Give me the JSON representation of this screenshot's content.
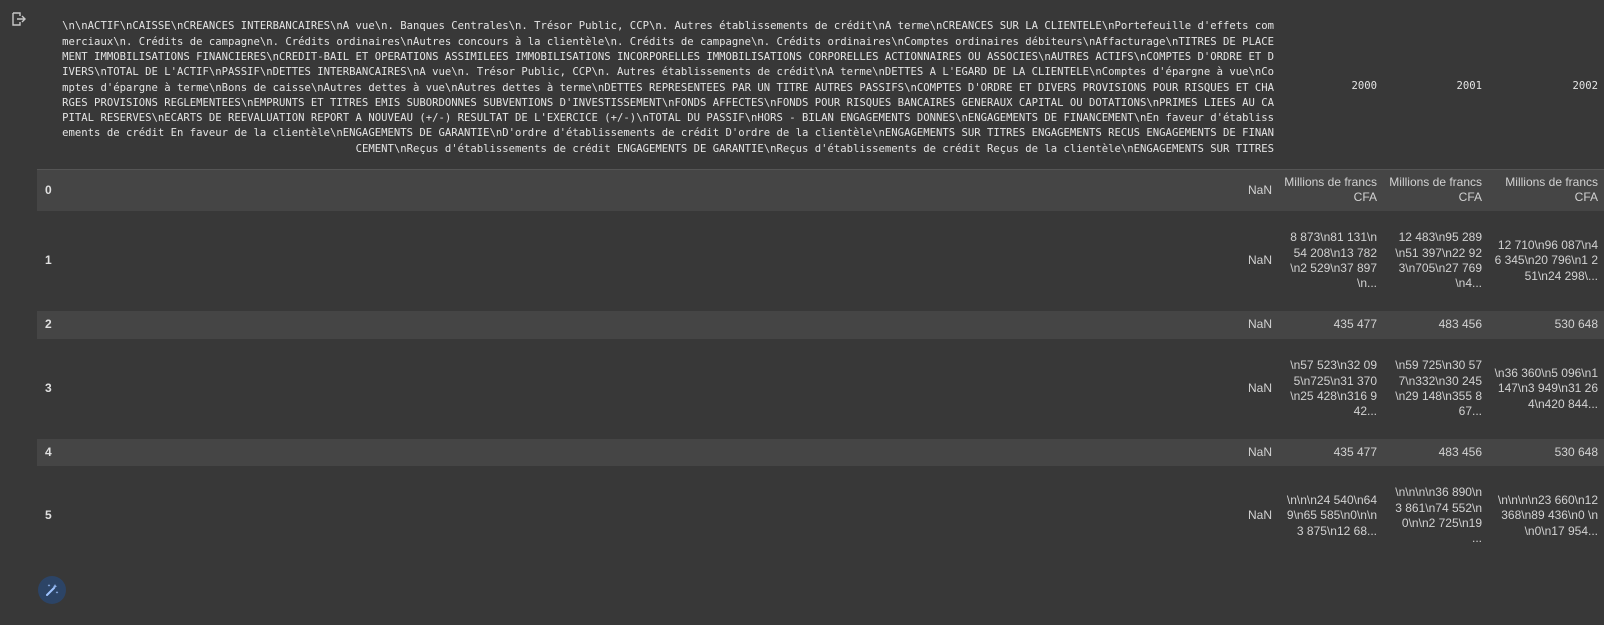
{
  "table": {
    "header": {
      "wide_col": "\\n\\nACTIF\\nCAISSE\\nCREANCES INTERBANCAIRES\\nA vue\\n. Banques Centrales\\n. Trésor Public, CCP\\n. Autres établissements de crédit\\nA terme\\nCREANCES SUR LA CLIENTELE\\nPortefeuille d'effets commerciaux\\n. Crédits de campagne\\n. Crédits ordinaires\\nAutres concours à la clientèle\\n. Crédits de campagne\\n. Crédits ordinaires\\nComptes ordinaires débiteurs\\nAffacturage\\nTITRES DE PLACEMENT IMMOBILISATIONS FINANCIERES\\nCREDIT-BAIL ET OPERATIONS ASSIMILEES IMMOBILISATIONS INCORPORELLES IMMOBILISATIONS CORPORELLES ACTIONNAIRES OU ASSOCIES\\nAUTRES ACTIFS\\nCOMPTES D'ORDRE ET DIVERS\\nTOTAL DE L'ACTIF\\nPASSIF\\nDETTES INTERBANCAIRES\\nA vue\\n. Trésor Public, CCP\\n. Autres établissements de crédit\\nA terme\\nDETTES A L'EGARD DE LA CLIENTELE\\nComptes d'épargne à vue\\nComptes d'épargne à terme\\nBons de caisse\\nAutres dettes à vue\\nAutres dettes à terme\\nDETTES REPRESENTEES PAR UN TITRE AUTRES PASSIFS\\nCOMPTES D'ORDRE ET DIVERS PROVISIONS POUR RISQUES ET CHARGES PROVISIONS REGLEMENTEES\\nEMPRUNTS ET TITRES EMIS SUBORDONNES SUBVENTIONS D'INVESTISSEMENT\\nFONDS AFFECTES\\nFONDS POUR RISQUES BANCAIRES GENERAUX CAPITAL OU DOTATIONS\\nPRIMES LIEES AU CAPITAL RESERVES\\nECARTS DE REEVALUATION REPORT A NOUVEAU (+/-) RESULTAT DE L'EXERCICE (+/-)\\nTOTAL DU PASSIF\\nHORS - BILAN ENGAGEMENTS DONNES\\nENGAGEMENTS DE FINANCEMENT\\nEn faveur d'établissements de crédit En faveur de la clientèle\\nENGAGEMENTS DE GARANTIE\\nD'ordre d'établissements de crédit D'ordre de la clientèle\\nENGAGEMENTS SUR TITRES ENGAGEMENTS RECUS ENGAGEMENTS DE FINANCEMENT\\nReçus d'établissements de crédit ENGAGEMENTS DE GARANTIE\\nReçus d'établissements de crédit Reçus de la clientèle\\nENGAGEMENTS SUR TITRES",
      "y2000": "2000",
      "y2001": "2001",
      "y2002": "2002"
    },
    "rows": [
      {
        "idx": "0",
        "c0": "NaN",
        "c1": "Millions de francs CFA",
        "c2": "Millions de francs CFA",
        "c3": "Millions de francs CFA"
      },
      {
        "idx": "1",
        "c0": "NaN",
        "c1": "8 873\\n81 131\\n54 208\\n13 782\\n2 529\\n37 897\\n...",
        "c2": "12 483\\n95 289\\n51 397\\n22 923\\n705\\n27 769\\n4...",
        "c3": "12 710\\n96 087\\n46 345\\n20 796\\n1 251\\n24 298\\..."
      },
      {
        "idx": "2",
        "c0": "NaN",
        "c1": "435 477",
        "c2": "483 456",
        "c3": "530 648"
      },
      {
        "idx": "3",
        "c0": "NaN",
        "c1": "\\n57 523\\n32 095\\n725\\n31 370\\n25 428\\n316 942...",
        "c2": "\\n59 725\\n30 577\\n332\\n30 245\\n29 148\\n355 867...",
        "c3": "\\n36 360\\n5 096\\n1 147\\n3 949\\n31 264\\n420 844..."
      },
      {
        "idx": "4",
        "c0": "NaN",
        "c1": "435 477",
        "c2": "483 456",
        "c3": "530 648"
      },
      {
        "idx": "5",
        "c0": "NaN",
        "c1": "\\n\\n\\n24 540\\n649\\n65 585\\n0\\n\\n3 875\\n12 68...",
        "c2": "\\n\\n\\n\\n36 890\\n3 861\\n74 552\\n0\\n\\n2 725\\n19 ...",
        "c3": "\\n\\n\\n\\n23 660\\n12 368\\n89 436\\n0 \\n\\n0\\n17 954..."
      }
    ]
  },
  "icons": {
    "output_icon": "output-arrow-icon",
    "wand_icon": "magic-wand-icon"
  },
  "colors": {
    "background": "#383838",
    "row_stripe": "#454545",
    "wand_bg": "#2c4466",
    "wand_fg": "#9ec3ff"
  }
}
